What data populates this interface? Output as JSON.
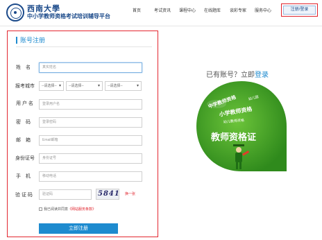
{
  "header": {
    "logo_title": "西南大學",
    "logo_subtitle": "中小学教师资格考试培训辅导平台",
    "nav": [
      {
        "label": "首页"
      },
      {
        "label": "考试资讯"
      },
      {
        "label": "课程中心"
      },
      {
        "label": "在线题库"
      },
      {
        "label": "谈彩专家"
      },
      {
        "label": "服务中心"
      }
    ],
    "login_register": "注册/登录"
  },
  "form": {
    "title": "账号注册",
    "fields": {
      "name": {
        "label": "姓　名",
        "placeholder": "真实姓名"
      },
      "city": {
        "label": "报考城市",
        "selects": [
          "--请选择--",
          "--请选择--",
          "--请选择--"
        ]
      },
      "username": {
        "label": "用 户 名",
        "placeholder": "登录用户名"
      },
      "password": {
        "label": "密　码",
        "placeholder": "登录密码"
      },
      "email": {
        "label": "邮　箱",
        "placeholder": "Email邮箱"
      },
      "idcard": {
        "label": "身份证号",
        "placeholder": "身份证号"
      },
      "phone": {
        "label": "手　机",
        "placeholder": "移动电话"
      },
      "captcha": {
        "label": "验 证 码",
        "placeholder": "验证码",
        "image_text": "5841",
        "refresh": "换一张"
      }
    },
    "agree_prefix": "我已阅读并同意",
    "agree_link": "《网站服务条款》",
    "submit": "立即注册"
  },
  "side": {
    "have_account": "已有账号？立即",
    "login_link": "登录",
    "badge": {
      "line1": "中学教师资格",
      "line1b": "幼儿园",
      "line2": "小学教师资格",
      "line3": "幼儿教师资格",
      "main": "教师资格证"
    }
  },
  "colors": {
    "accent": "#1e8bcf",
    "brand": "#1b4a8a",
    "highlight": "#e3262f",
    "badge_green": "#4aa02c"
  }
}
